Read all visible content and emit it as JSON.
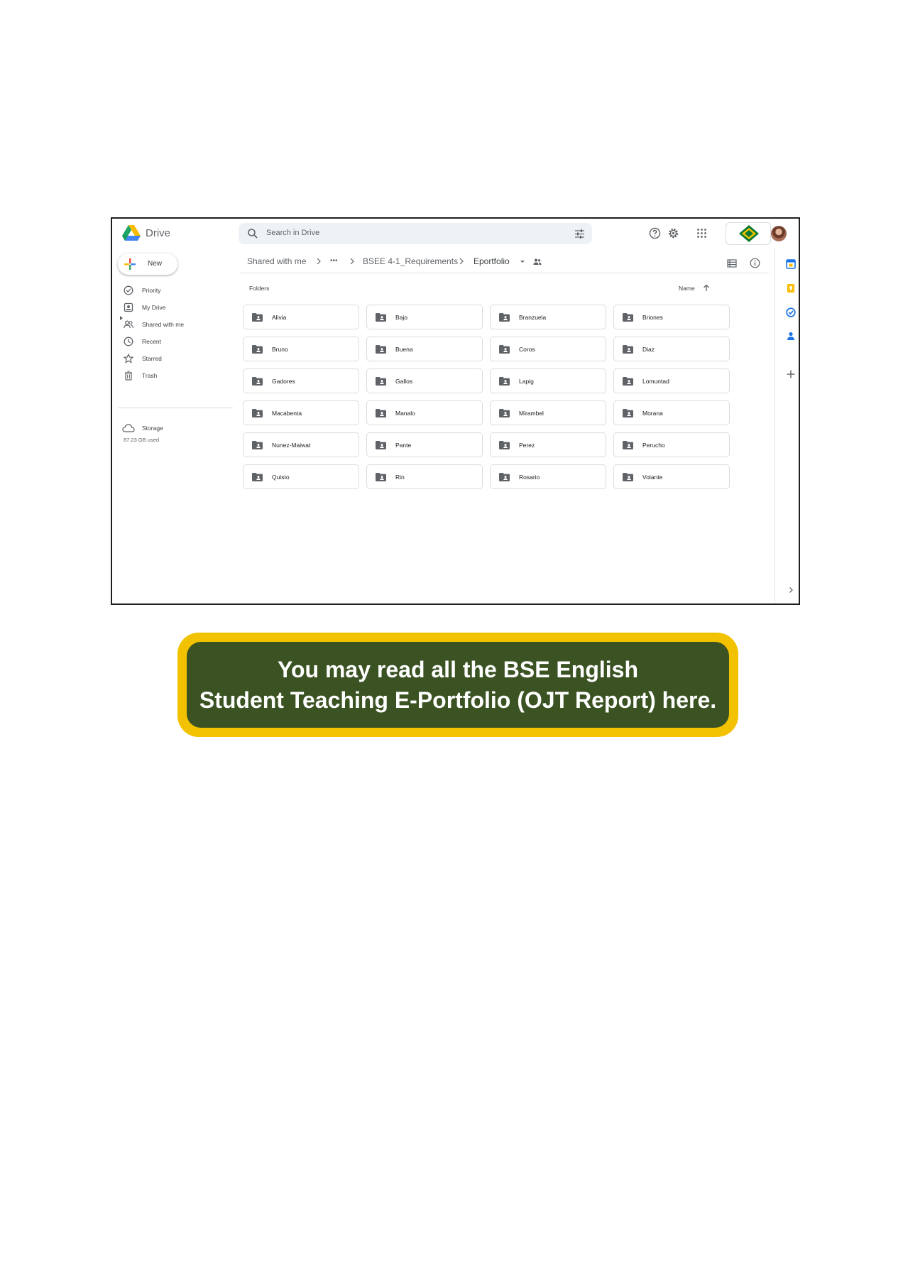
{
  "app": {
    "name": "Drive"
  },
  "search": {
    "placeholder": "Search in Drive"
  },
  "new_button": {
    "label": "New"
  },
  "sidebar": {
    "items": [
      {
        "label": "Priority",
        "icon": "priority-icon"
      },
      {
        "label": "My Drive",
        "icon": "my-drive-icon"
      },
      {
        "label": "Shared with me",
        "icon": "shared-icon"
      },
      {
        "label": "Recent",
        "icon": "clock-icon"
      },
      {
        "label": "Starred",
        "icon": "star-icon"
      },
      {
        "label": "Trash",
        "icon": "trash-icon"
      }
    ],
    "storage": {
      "label": "Storage",
      "used": "87.23 GB used"
    }
  },
  "breadcrumb": {
    "items": [
      "Shared with me",
      "•••",
      "BSEE 4-1_Requirements",
      "Eportfolio"
    ]
  },
  "folders_label": "Folders",
  "sort": {
    "label": "Name"
  },
  "folders": [
    "Alivia",
    "Bajo",
    "Branzuela",
    "Briones",
    "Bruno",
    "Buena",
    "Coros",
    "Diaz",
    "Gadores",
    "Gallos",
    "Lapig",
    "Lomuntad",
    "Macabenta",
    "Manalo",
    "Mirambel",
    "Morana",
    "Nunez-Maiwat",
    "Pante",
    "Perez",
    "Perucho",
    "Quisto",
    "Rin",
    "Rosario",
    "Volante"
  ],
  "banner": {
    "line1": "You may read all the BSE English",
    "line2": "Student Teaching E-Portfolio (OJT Report) here."
  },
  "colors": {
    "banner_border": "#f2c200",
    "banner_fill": "#3b5323",
    "search_bg": "#eef1f5"
  }
}
